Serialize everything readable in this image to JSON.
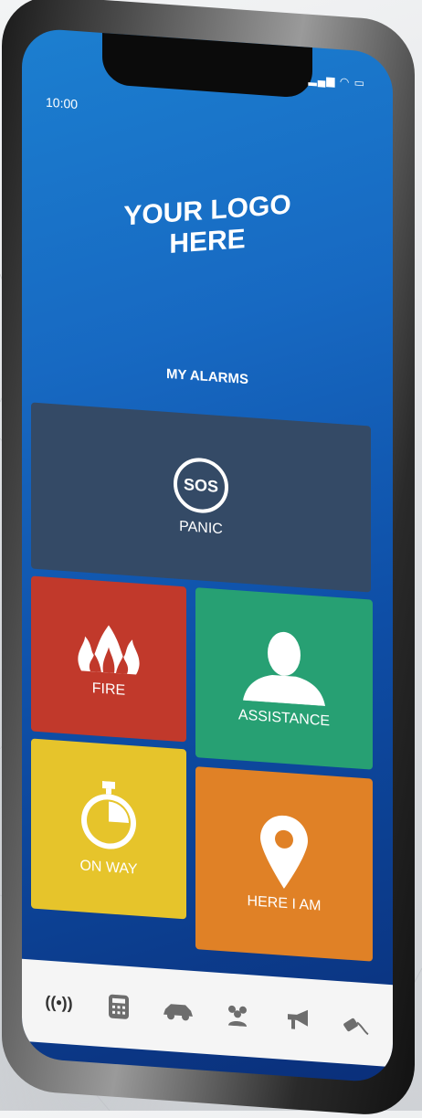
{
  "status_bar": {
    "time": "10:00",
    "signal_icons": "signal-wifi-battery"
  },
  "logo": {
    "line1": "YOUR LOGO",
    "line2": "HERE"
  },
  "section": {
    "title": "MY ALARMS"
  },
  "tiles": [
    {
      "id": "panic",
      "label": "PANIC",
      "badge": "SOS",
      "color": "#344a66",
      "icon": "sos-icon"
    },
    {
      "id": "fire",
      "label": "FIRE",
      "color": "#c1392b",
      "icon": "fire-icon"
    },
    {
      "id": "assistance",
      "label": "ASSISTANCE",
      "color": "#27a073",
      "icon": "person-icon"
    },
    {
      "id": "on-way",
      "label": "ON WAY",
      "color": "#e6c42b",
      "icon": "stopwatch-icon"
    },
    {
      "id": "here-i-am",
      "label": "HERE I AM",
      "color": "#e08126",
      "icon": "location-pin-icon"
    }
  ],
  "tab_bar": {
    "items": [
      {
        "icon": "alarm-broadcast-icon",
        "active": true
      },
      {
        "icon": "calculator-icon"
      },
      {
        "icon": "car-icon"
      },
      {
        "icon": "group-icon"
      },
      {
        "icon": "megaphone-icon"
      },
      {
        "icon": "plug-icon"
      }
    ]
  }
}
